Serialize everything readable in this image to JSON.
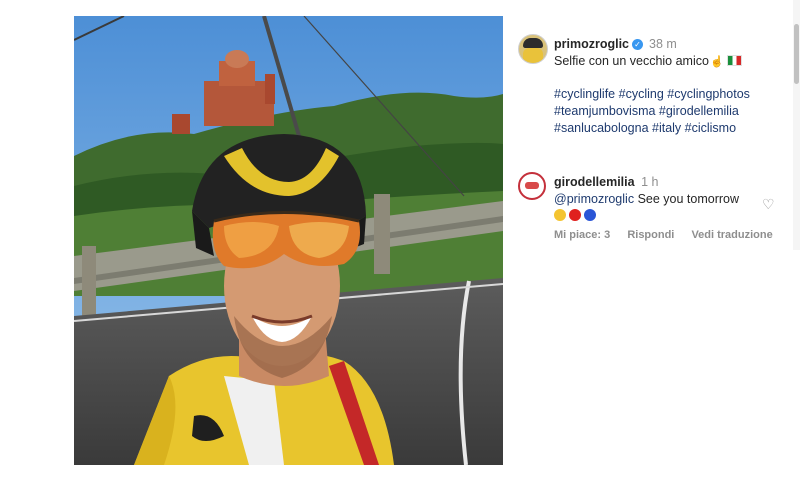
{
  "post": {
    "username": "primozroglic",
    "time": "38 m",
    "caption": "Selfie con un vecchio amico",
    "hashtag_lines": [
      "#cyclinglife #cycling #cyclingphotos",
      "#teamjumbovisma #girodellemilia",
      "#sanlucabologna #italy #ciclismo"
    ]
  },
  "comment": {
    "username": "girodellemilia",
    "time": "1 h",
    "mention": "@primozroglic",
    "text": "See you tomorrow",
    "likes_label": "Mi piace: 3",
    "reply_label": "Rispondi",
    "translate_label": "Vedi traduzione"
  },
  "colors": {
    "link": "#1e3a6e",
    "muted": "#8e8e8e",
    "verified": "#3897f0"
  },
  "icons": [
    "verified-badge-icon",
    "waving-hand-icon",
    "italy-flag-icon",
    "heart-icon"
  ]
}
